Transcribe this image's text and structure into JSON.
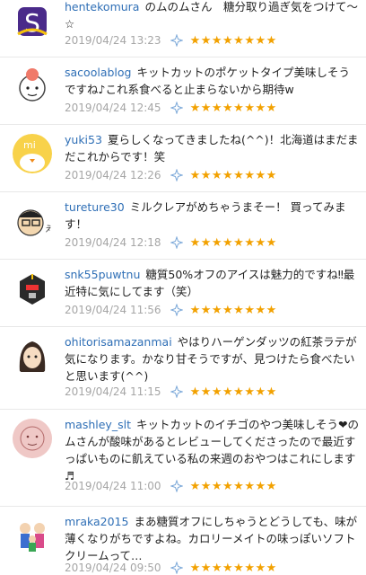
{
  "comments": [
    {
      "user": "hentekomura",
      "text": "のムのムさん　糖分取り過ぎ気をつけて〜☆",
      "date": "2019/04/24 13:23",
      "stars": "★★★★★★★★"
    },
    {
      "user": "sacoolablog",
      "text": "キットカットのポケットタイプ美味しそうですね♪これ系食べると止まらないから期待w",
      "date": "2019/04/24 12:45",
      "stars": "★★★★★★★★"
    },
    {
      "user": "yuki53",
      "text": "夏らしくなってきましたね(^^)！北海道はまだまだこれからです！笑",
      "date": "2019/04/24 12:26",
      "stars": "★★★★★★★★"
    },
    {
      "user": "tureture30",
      "text": "ミルクレアがめちゃうまそー！ 買ってみます！",
      "date": "2019/04/24 12:18",
      "stars": "★★★★★★★★"
    },
    {
      "user": "snk55puwtnu",
      "text": "糖質50%オフのアイスは魅力的ですね‼︎最近特に気にしてます（笑）",
      "date": "2019/04/24 11:56",
      "stars": "★★★★★★★★"
    },
    {
      "user": "ohitorisamazanmai",
      "text": "やはりハーゲンダッツの紅茶ラテが気になります。かなり甘そうですが、見つけたら食べたいと思います(^^)",
      "date": "2019/04/24 11:15",
      "stars": "★★★★★★★★"
    },
    {
      "user": "mashley_slt",
      "text": "キットカットのイチゴのやつ美味しそう❤のムさんが酸味があるとレビューしてくださったので最近すっぱいものに飢えている私の来週のおやつはこれにします♬",
      "date": "2019/04/24 11:00",
      "stars": "★★★★★★★★"
    },
    {
      "user": "mraka2015",
      "text": "まあ糖質オフにしちゃうとどうしても、味が薄くなりがちですよね。カロリーメイトの味っぽいソフトクリームって…",
      "date": "2019/04/24 09:50",
      "stars": "★★★★★★★★"
    }
  ]
}
